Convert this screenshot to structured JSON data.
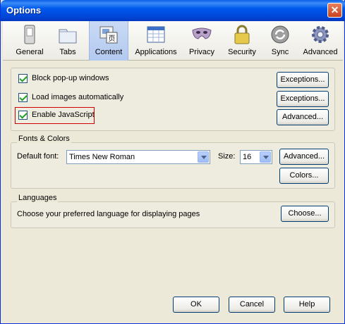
{
  "window": {
    "title": "Options"
  },
  "toolbar": {
    "tabs": [
      {
        "label": "General",
        "icon": "general-icon"
      },
      {
        "label": "Tabs",
        "icon": "tabs-icon"
      },
      {
        "label": "Content",
        "icon": "content-icon",
        "active": true
      },
      {
        "label": "Applications",
        "icon": "applications-icon"
      },
      {
        "label": "Privacy",
        "icon": "privacy-mask-icon"
      },
      {
        "label": "Security",
        "icon": "security-lock-icon"
      },
      {
        "label": "Sync",
        "icon": "sync-icon"
      },
      {
        "label": "Advanced",
        "icon": "advanced-gear-icon"
      }
    ]
  },
  "content": {
    "block_popups": {
      "label": "Block pop-up windows",
      "checked": true,
      "button": "Exceptions..."
    },
    "load_images": {
      "label": "Load images automatically",
      "checked": true,
      "button": "Exceptions..."
    },
    "enable_js": {
      "label": "Enable JavaScript",
      "checked": true,
      "button": "Advanced..."
    }
  },
  "fonts": {
    "title": "Fonts & Colors",
    "default_font_label": "Default font:",
    "default_font_value": "Times New Roman",
    "size_label": "Size:",
    "size_value": "16",
    "advanced_button": "Advanced...",
    "colors_button": "Colors..."
  },
  "languages": {
    "title": "Languages",
    "description": "Choose your preferred language for displaying pages",
    "choose_button": "Choose..."
  },
  "footer": {
    "ok": "OK",
    "cancel": "Cancel",
    "help": "Help"
  },
  "colors": {
    "titlebar": "#0058ee",
    "highlight": "#d00000",
    "check": "#21a121"
  }
}
